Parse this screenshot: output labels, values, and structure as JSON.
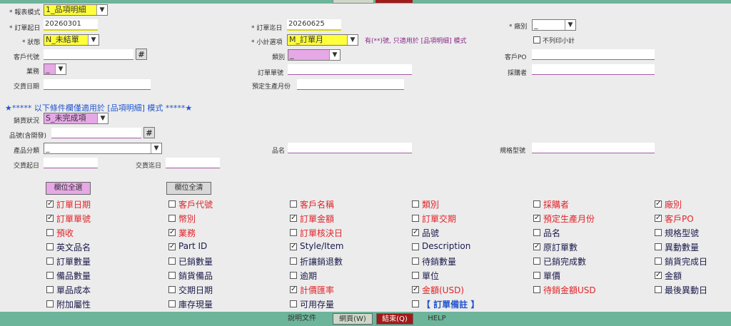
{
  "form": {
    "report_mode": {
      "label": "* 報表模式",
      "value": "1_品項明細"
    },
    "order_start": {
      "label": "* 訂單起日",
      "value": "20260301"
    },
    "order_end": {
      "label": "* 訂單迄日",
      "value": "20260625"
    },
    "factory": {
      "label": "* 廠別",
      "value": "_"
    },
    "status": {
      "label": "* 狀態",
      "value": "N_未結單"
    },
    "subtotal": {
      "label": "* 小計選項",
      "value": "M_訂單月"
    },
    "subtotal_note": "有(**)號, 只適用於 [品項明細] 模式",
    "no_subtotal": "不列印小計",
    "customer_code": {
      "label": "客戶代號",
      "value": ""
    },
    "category": {
      "label": "類別",
      "value": "_"
    },
    "customer_po": {
      "label": "客戶PO",
      "value": ""
    },
    "sales": {
      "label": "業務",
      "value": "_"
    },
    "order_no": {
      "label": "訂單單號",
      "value": ""
    },
    "buyer": {
      "label": "採購者",
      "value": ""
    },
    "delivery_date": {
      "label": "交貨日期",
      "value": ""
    },
    "planned_month": {
      "label": "預定生產月份",
      "value": ""
    },
    "hash": "#"
  },
  "conditions": {
    "heading": "★***** 以下條件欄僅適用於 [品項明細] 模式 *****★",
    "sales_status": {
      "label": "銷貨狀況",
      "value": "S_未完成項"
    },
    "part_no": {
      "label": "品號(含開發)",
      "value": ""
    },
    "product_category": {
      "label": "產品分類",
      "value": "_"
    },
    "product_name": {
      "label": "品名",
      "value": ""
    },
    "spec_model": {
      "label": "規格型號",
      "value": ""
    },
    "delivery_start": {
      "label": "交貨起日",
      "value": ""
    },
    "delivery_end": {
      "label": "交貨迄日",
      "value": ""
    }
  },
  "buttons": {
    "select_all": "欄位全選",
    "clear_all": "欄位全清"
  },
  "columns": [
    [
      {
        "t": "訂單日期",
        "c": true,
        "r": true
      },
      {
        "t": "客戶代號",
        "c": false,
        "r": true
      },
      {
        "t": "客戶名稱",
        "c": false,
        "r": true
      },
      {
        "t": "類別",
        "c": false,
        "r": true
      },
      {
        "t": "採購者",
        "c": false,
        "r": true
      },
      {
        "t": "廠別",
        "c": true,
        "r": true
      }
    ],
    [
      {
        "t": "訂單單號",
        "c": true,
        "r": true
      },
      {
        "t": "幣別",
        "c": false,
        "r": true
      },
      {
        "t": "訂單金額",
        "c": true,
        "r": true
      },
      {
        "t": "訂單交期",
        "c": false,
        "r": true
      },
      {
        "t": "預定生產月份",
        "c": true,
        "r": true
      },
      {
        "t": "客戶PO",
        "c": true,
        "r": true
      }
    ],
    [
      {
        "t": "預收",
        "c": false,
        "r": true
      },
      {
        "t": "業務",
        "c": true,
        "r": true
      },
      {
        "t": "訂單核決日",
        "c": false,
        "r": true
      },
      {
        "t": "品號",
        "c": true,
        "r": false
      },
      {
        "t": "品名",
        "c": false,
        "r": false
      },
      {
        "t": "規格型號",
        "c": false,
        "r": false
      }
    ],
    [
      {
        "t": "英文品名",
        "c": false,
        "r": false
      },
      {
        "t": "Part ID",
        "c": true,
        "r": false
      },
      {
        "t": "Style/Item",
        "c": true,
        "r": false
      },
      {
        "t": "Description",
        "c": false,
        "r": false
      },
      {
        "t": "原訂單數",
        "c": true,
        "r": false
      },
      {
        "t": "異動數量",
        "c": false,
        "r": false
      }
    ],
    [
      {
        "t": "訂單數量",
        "c": false,
        "r": false
      },
      {
        "t": "已銷數量",
        "c": false,
        "r": false
      },
      {
        "t": "折讓銷退數",
        "c": false,
        "r": false
      },
      {
        "t": "待銷數量",
        "c": false,
        "r": false
      },
      {
        "t": "已銷完成數",
        "c": false,
        "r": false
      },
      {
        "t": "銷貨完成日",
        "c": false,
        "r": false
      }
    ],
    [
      {
        "t": "備品數量",
        "c": false,
        "r": false
      },
      {
        "t": "銷貨備品",
        "c": false,
        "r": false
      },
      {
        "t": "逾期",
        "c": false,
        "r": false
      },
      {
        "t": "單位",
        "c": false,
        "r": false
      },
      {
        "t": "單價",
        "c": false,
        "r": false
      },
      {
        "t": "金額",
        "c": true,
        "r": false
      }
    ],
    [
      {
        "t": "單品成本",
        "c": false,
        "r": false
      },
      {
        "t": "交期日期",
        "c": false,
        "r": false
      },
      {
        "t": "計價匯率",
        "c": true,
        "r": true
      },
      {
        "t": "金額(USD)",
        "c": true,
        "r": true
      },
      {
        "t": "待銷金額USD",
        "c": false,
        "r": true
      },
      {
        "t": "最後異動日",
        "c": false,
        "r": false
      }
    ],
    [
      {
        "t": "附加屬性",
        "c": false,
        "r": false
      },
      {
        "t": "庫存現量",
        "c": false,
        "r": false
      },
      {
        "t": "可用存量",
        "c": false,
        "r": false
      },
      {
        "t": "【 訂單備註 】",
        "c": false,
        "r": false,
        "b": true
      }
    ]
  ],
  "footer": {
    "doc": "說明文件",
    "web": "網頁(W)",
    "exit": "結束(Q)",
    "help": "HELP"
  },
  "colors": {
    "green": "#6db59a",
    "exit": "#a11a1a",
    "yellow": "#ffff3c",
    "pink": "#e6a8e6",
    "red": "#e0242a"
  },
  "checkbox_mark": "✓"
}
